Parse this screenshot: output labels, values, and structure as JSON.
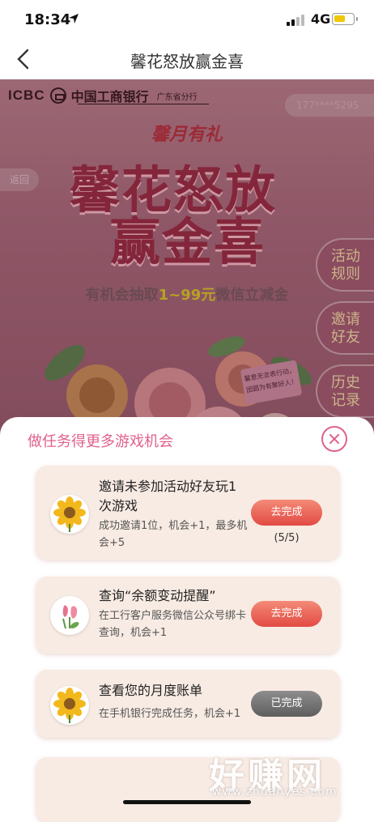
{
  "status_bar": {
    "time": "18:34",
    "network": "4G"
  },
  "nav": {
    "title": "馨花怒放赢金喜"
  },
  "hero": {
    "bank_abbr": "ICBC",
    "bank_name": "中国工商银行",
    "branch": "广东省分行",
    "phone": "177****5295",
    "return_label": "返回",
    "slogan": "馨月有礼",
    "headline_1": "馨花怒放",
    "headline_2": "赢金喜",
    "subline_prefix": "有机会抽取",
    "subline_amount": "1~99元",
    "subline_suffix": "微信立减金",
    "side_buttons": [
      {
        "line1": "活动",
        "line2": "规则"
      },
      {
        "line1": "邀请",
        "line2": "好友"
      },
      {
        "line1": "历史",
        "line2": "记录"
      }
    ],
    "card_note": "馨意无言表行动，团圆为有聚好人！"
  },
  "sheet": {
    "title": "做任务得更多游戏机会",
    "tasks": [
      {
        "title": "邀请未参加活动好友玩1次游戏",
        "desc": "成功邀请1位，机会+1，最多机会+5",
        "action": "去完成",
        "progress": "(5/5)",
        "icon": "sunflower-icon",
        "state": "todo"
      },
      {
        "title": "查询“余额变动提醒”",
        "desc": "在工行客户服务微信公众号绑卡查询，机会+1",
        "action": "去完成",
        "icon": "tulip-icon",
        "state": "todo"
      },
      {
        "title": "查看您的月度账单",
        "desc": "在手机银行完成任务，机会+1",
        "action": "已完成",
        "icon": "sunflower-icon",
        "state": "done"
      }
    ]
  },
  "watermark": {
    "text": "好赚网",
    "url": "www.zhuanyes.com"
  },
  "colors": {
    "accent_pink": "#e0608e",
    "action_red": "#e24a44",
    "done_gray": "#6e6e6e",
    "card_bg": "#f8ebe3"
  }
}
